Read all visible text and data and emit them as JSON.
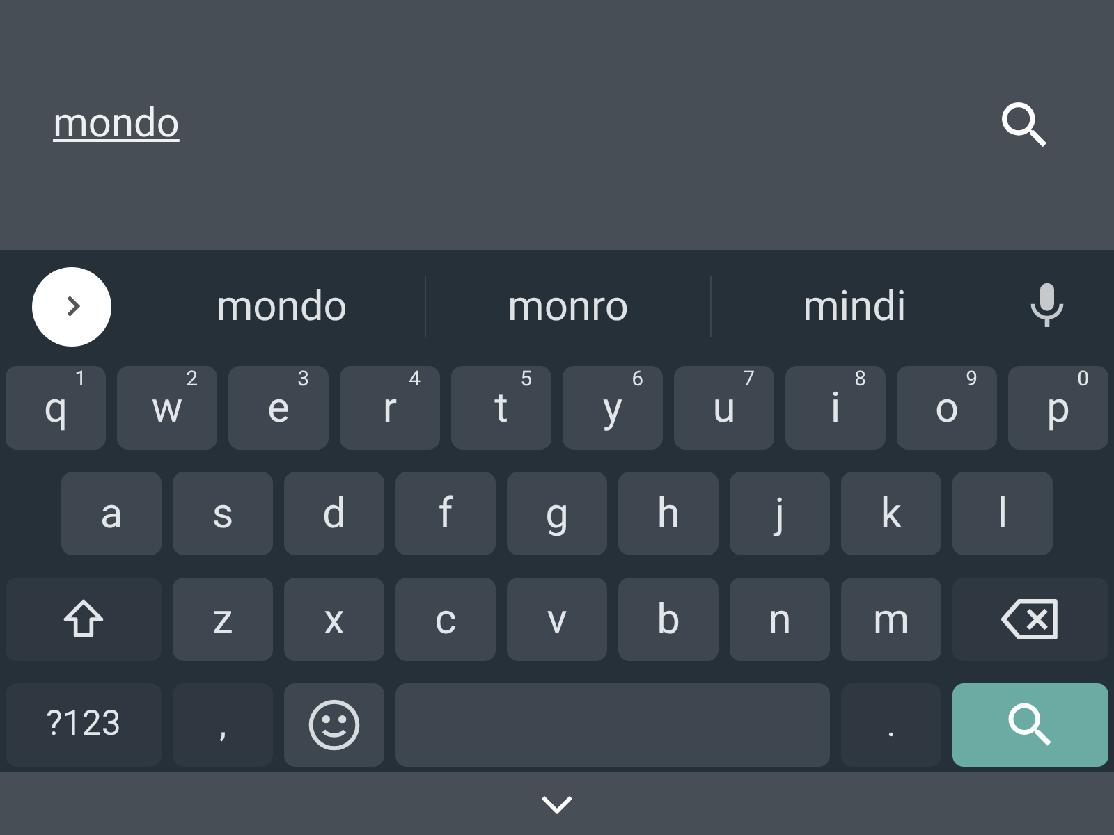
{
  "search": {
    "value": "mondo"
  },
  "suggestions": [
    "mondo",
    "monro",
    "mindi"
  ],
  "rows": [
    [
      {
        "kind": "letter",
        "label": "q",
        "hint": "1"
      },
      {
        "kind": "letter",
        "label": "w",
        "hint": "2"
      },
      {
        "kind": "letter",
        "label": "e",
        "hint": "3"
      },
      {
        "kind": "letter",
        "label": "r",
        "hint": "4"
      },
      {
        "kind": "letter",
        "label": "t",
        "hint": "5"
      },
      {
        "kind": "letter",
        "label": "y",
        "hint": "6"
      },
      {
        "kind": "letter",
        "label": "u",
        "hint": "7"
      },
      {
        "kind": "letter",
        "label": "i",
        "hint": "8"
      },
      {
        "kind": "letter",
        "label": "o",
        "hint": "9"
      },
      {
        "kind": "letter",
        "label": "p",
        "hint": "0"
      }
    ],
    [
      {
        "kind": "letter",
        "label": "a"
      },
      {
        "kind": "letter",
        "label": "s"
      },
      {
        "kind": "letter",
        "label": "d"
      },
      {
        "kind": "letter",
        "label": "f"
      },
      {
        "kind": "letter",
        "label": "g"
      },
      {
        "kind": "letter",
        "label": "h"
      },
      {
        "kind": "letter",
        "label": "j"
      },
      {
        "kind": "letter",
        "label": "k"
      },
      {
        "kind": "letter",
        "label": "l"
      }
    ],
    [
      {
        "kind": "shift"
      },
      {
        "kind": "letter",
        "label": "z"
      },
      {
        "kind": "letter",
        "label": "x"
      },
      {
        "kind": "letter",
        "label": "c"
      },
      {
        "kind": "letter",
        "label": "v"
      },
      {
        "kind": "letter",
        "label": "b"
      },
      {
        "kind": "letter",
        "label": "n"
      },
      {
        "kind": "letter",
        "label": "m"
      },
      {
        "kind": "backspace"
      }
    ],
    [
      {
        "kind": "symbols",
        "label": "?123"
      },
      {
        "kind": "punct",
        "label": ","
      },
      {
        "kind": "emoji"
      },
      {
        "kind": "space"
      },
      {
        "kind": "punct",
        "label": "."
      },
      {
        "kind": "search"
      }
    ]
  ]
}
